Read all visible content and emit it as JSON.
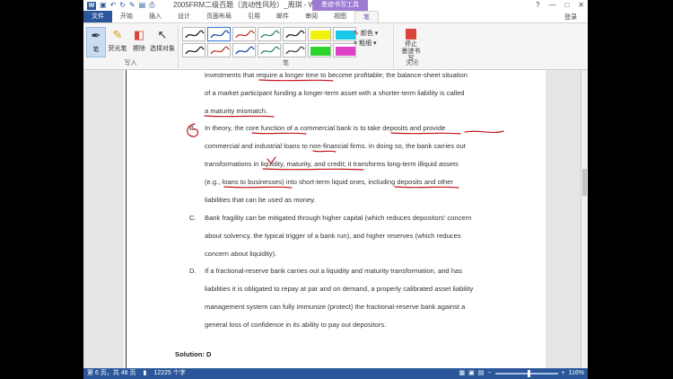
{
  "titlebar": {
    "logo": "W",
    "title": "2005FRM二级百题（流动性风险）_周琪 - Word",
    "contextual_tab": "墨迹书写工具",
    "help": "?",
    "minimize": "—",
    "restore": "□",
    "close": "✕"
  },
  "tabs": [
    "文件",
    "开始",
    "插入",
    "设计",
    "页面布局",
    "引用",
    "邮件",
    "审阅",
    "视图",
    "笔"
  ],
  "login": "登录",
  "ribbon": {
    "write_group": "写入",
    "pen_label": "笔",
    "highlighter_label": "荧光笔",
    "eraser_label": "擦除",
    "select_label": "选择对象",
    "pens_group": "笔",
    "color_label": "颜色",
    "thickness_label": "粗细",
    "close_group": "关闭",
    "stop_label": "停止\n墨迹书写"
  },
  "pens": [
    {
      "color": "#222222"
    },
    {
      "color": "#1f4e9a"
    },
    {
      "color": "#c0392b"
    },
    {
      "color": "#2e8b57"
    },
    {
      "color": "#222222"
    },
    {
      "color": "#f2f20a"
    },
    {
      "color": "#18c8e8"
    },
    {
      "color": "#222222"
    },
    {
      "color": "#c0392b"
    },
    {
      "color": "#1f4e9a"
    },
    {
      "color": "#2e8b57"
    },
    {
      "color": "#444444"
    },
    {
      "color": "#2bd42b"
    },
    {
      "color": "#e040c8"
    }
  ],
  "document": {
    "para_a": [
      "investments that require a longer time to become profitable; the balance-sheet situation",
      "of a market participant funding a longer-term asset with a shorter-term liability is called",
      "a maturity mismatch."
    ],
    "opt_b": "B.",
    "para_b": [
      "In theory, the core function of a commercial bank is to take deposits and provide",
      "commercial and industrial loans to non-financial firms. In doing so, the bank carries out",
      "transformations in liquidity, maturity, and credit; it transforms long-term illiquid assets",
      "(e.g., loans to businesses) into short-term liquid ones, including deposits and other",
      "liabilities that can be used as money."
    ],
    "opt_c": "C.",
    "para_c": [
      "Bank fragility can be mitigated through higher capital (which reduces depositors' concern",
      "about solvency, the typical trigger of a bank run), and higher reserves (which reduces",
      "concern about liquidity)."
    ],
    "opt_d": "D.",
    "para_d": [
      "If a fractional-reserve bank carries out a liquidity and maturity transformation, and has",
      "liabilities it is obligated to repay at par and on demand, a properly calibrated asset liability",
      "management system can fully immunize (protect) the fractional-reserve bank against a",
      "general loss of confidence in its ability to pay out depositors."
    ],
    "solution": "Solution: D"
  },
  "status": {
    "page": "第 6 页，共 48 页",
    "words": "12225 个字",
    "zoom": "116%"
  },
  "ink_color": "#c4161c"
}
